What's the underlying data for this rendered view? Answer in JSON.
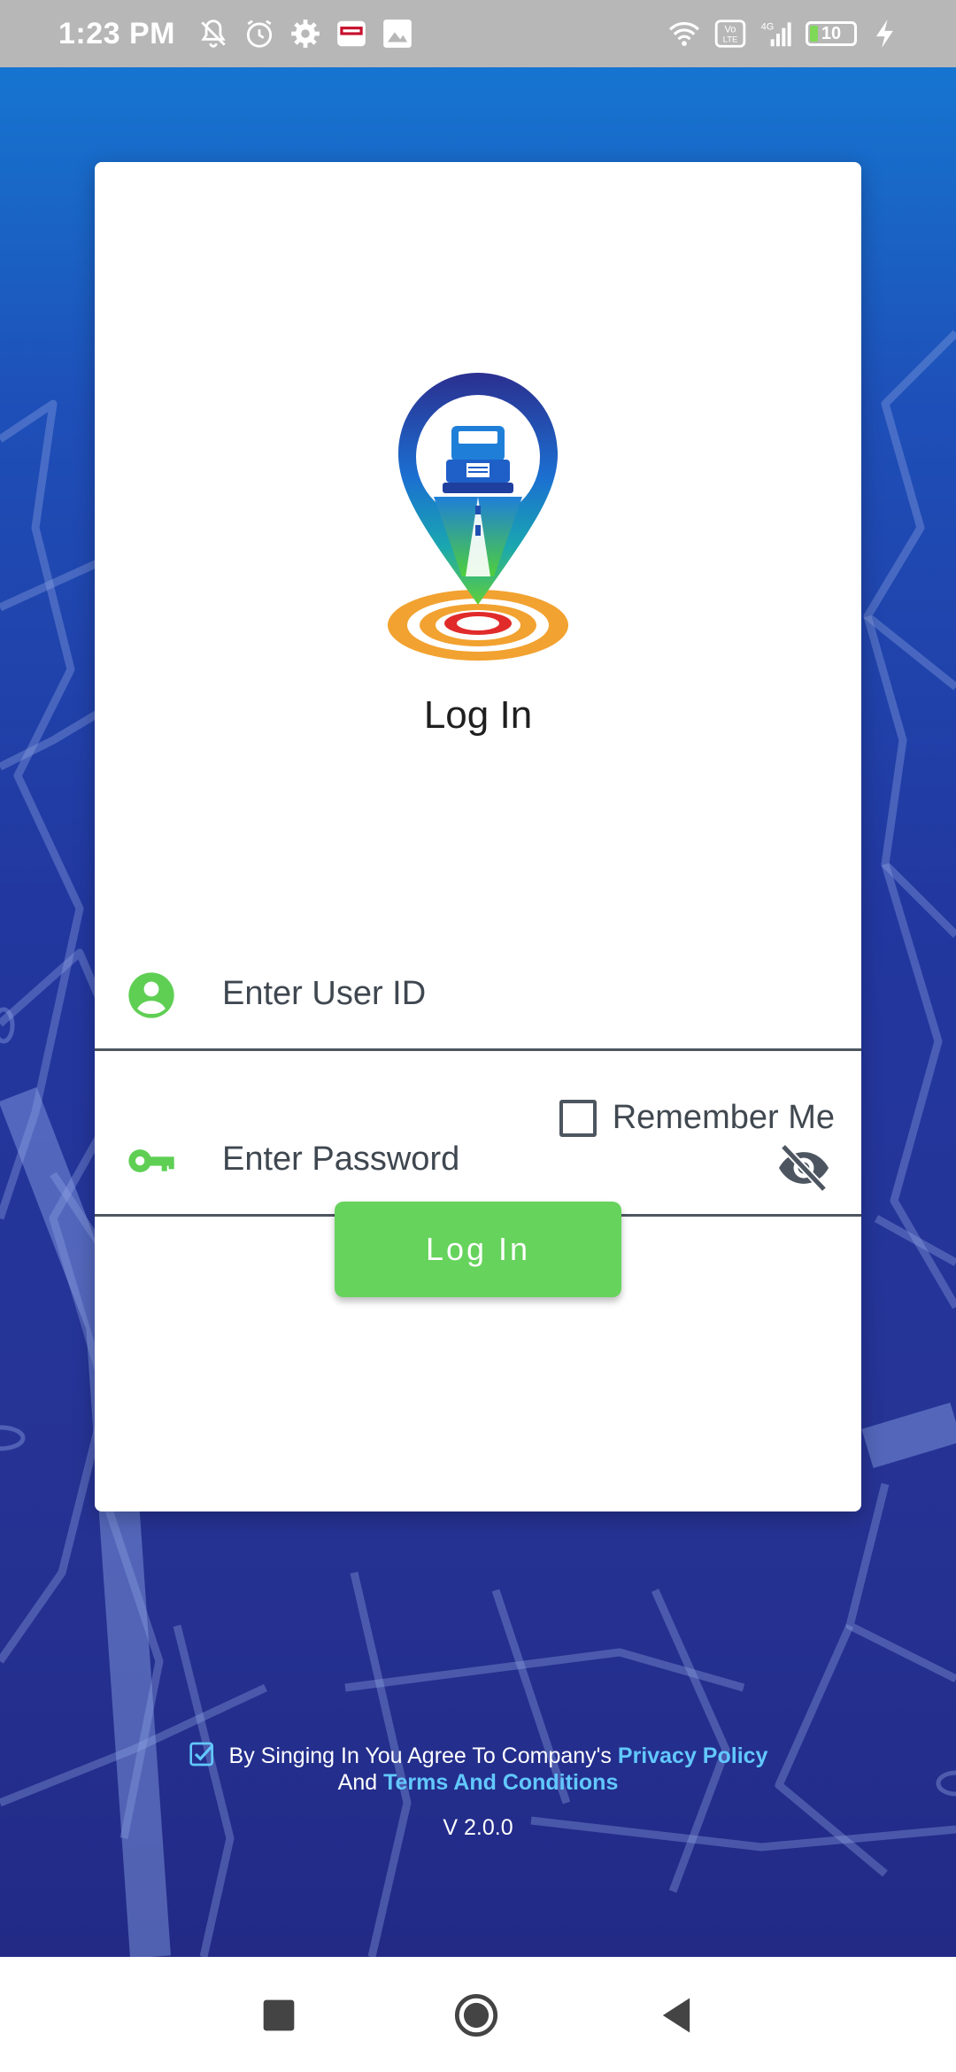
{
  "status_bar": {
    "time": "1:23 PM",
    "battery": "10",
    "icons": [
      "bell-off-icon",
      "alarm-icon",
      "gear-icon",
      "bank-app-icon",
      "image-icon",
      "wifi-icon",
      "volte-icon",
      "signal-4g-icon",
      "charging-icon"
    ]
  },
  "login": {
    "title": "Log In",
    "user_id_placeholder": "Enter User ID",
    "password_placeholder": "Enter Password",
    "remember_label": "Remember Me",
    "button_label": "Log In"
  },
  "footer": {
    "terms_prefix": "By Singing In You Agree To Company's",
    "privacy_link": "Privacy Policy",
    "and_text": "And",
    "terms_link": "Terms And Conditions",
    "version": "V 2.0.0"
  },
  "colors": {
    "accent_green": "#66d35c",
    "link_blue": "#62c8ff",
    "background_top": "#1675d0",
    "background_bottom": "#222a86"
  }
}
